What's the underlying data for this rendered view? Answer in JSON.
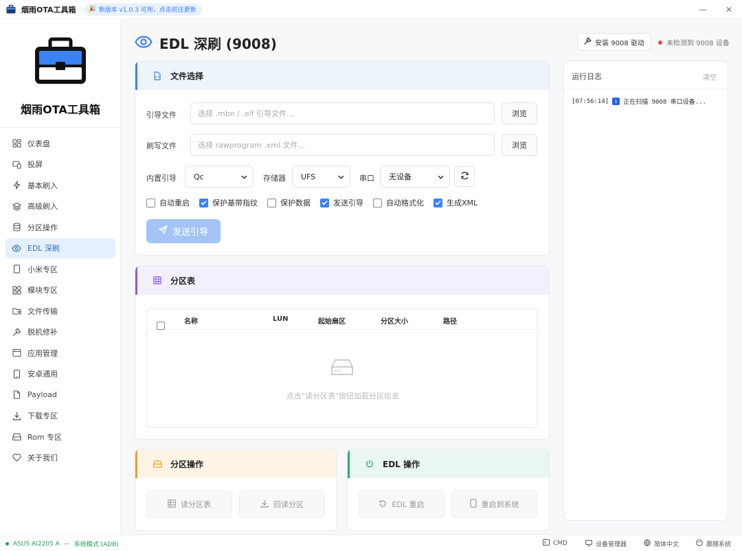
{
  "titlebar": {
    "title": "烟雨OTA工具箱",
    "update_badge": "新版本 v1.0.3 可用，点击前往更新",
    "minimize": "—",
    "close": "✕"
  },
  "sidebar": {
    "app_name": "烟雨OTA工具箱",
    "items": [
      {
        "label": "仪表盘",
        "icon": "dashboard-icon"
      },
      {
        "label": "投屏",
        "icon": "cast-icon"
      },
      {
        "label": "基本刷入",
        "icon": "bolt-icon"
      },
      {
        "label": "高级刷入",
        "icon": "layers-icon"
      },
      {
        "label": "分区操作",
        "icon": "database-icon"
      },
      {
        "label": "EDL 深刷",
        "icon": "eye-icon",
        "active": true
      },
      {
        "label": "小米专区",
        "icon": "phone-icon"
      },
      {
        "label": "模块专区",
        "icon": "blocks-icon"
      },
      {
        "label": "文件传输",
        "icon": "folder-transfer-icon"
      },
      {
        "label": "脱机修补",
        "icon": "wrench-icon"
      },
      {
        "label": "应用管理",
        "icon": "app-window-icon"
      },
      {
        "label": "安卓通用",
        "icon": "android-phone-icon"
      },
      {
        "label": "Payload",
        "icon": "file-icon"
      },
      {
        "label": "下载专区",
        "icon": "download-icon"
      },
      {
        "label": "Rom 专区",
        "icon": "drive-icon"
      },
      {
        "label": "关于我们",
        "icon": "heart-icon"
      }
    ]
  },
  "header": {
    "title": "EDL 深刷 (9008)",
    "driver_button": "安装 9008 驱动",
    "device_status": "未检测到 9008 设备",
    "status_color": "#e24c4c"
  },
  "file_card": {
    "title": "文件选择",
    "loader_label": "引导文件",
    "loader_placeholder": "选择 .mbn / .elf 引导文件...",
    "flash_label": "刷写文件",
    "flash_placeholder": "选择 rawprogram .xml 文件...",
    "browse": "浏览",
    "builtin_label": "内置引导",
    "builtin_value": "Qc",
    "storage_label": "存储器",
    "storage_value": "UFS",
    "port_label": "串口",
    "port_value": "无设备",
    "checkboxes": [
      {
        "label": "自动重启",
        "checked": false
      },
      {
        "label": "保护基带指纹",
        "checked": true
      },
      {
        "label": "保护数据",
        "checked": false
      },
      {
        "label": "发送引导",
        "checked": true
      },
      {
        "label": "自动格式化",
        "checked": false
      },
      {
        "label": "生成XML",
        "checked": true
      }
    ],
    "send_button": "发送引导"
  },
  "partition_card": {
    "title": "分区表",
    "columns": [
      "名称",
      "LUN",
      "起始扇区",
      "分区大小",
      "路径"
    ],
    "empty_text": "点击\"读分区表\"按钮加载分区信息"
  },
  "partition_ops": {
    "title": "分区操作",
    "read_table": "读分区表",
    "readback": "回读分区"
  },
  "edl_ops": {
    "title": "EDL 操作",
    "reboot": "EDL 重启",
    "reboot_system": "重启到系统"
  },
  "log": {
    "title": "运行日志",
    "clear": "清空",
    "lines": [
      {
        "time": "[07:56:14]",
        "badge": "i",
        "text": "正在扫描 9008 串口设备..."
      }
    ]
  },
  "statusbar": {
    "device": "ASUS AI2205 A",
    "separator": "—",
    "mode": "系统模式 (ADB)",
    "cmd": "CMD",
    "device_manager": "设备管理器",
    "language": "简体中文",
    "follow_system": "跟随系统"
  }
}
